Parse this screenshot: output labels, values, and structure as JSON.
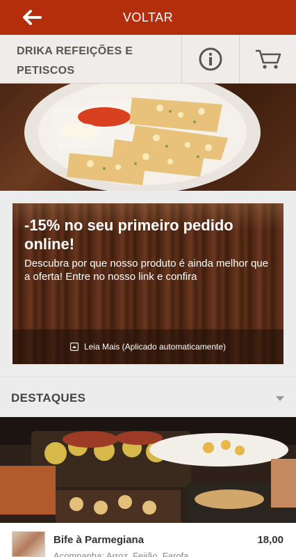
{
  "topbar": {
    "title": "VOLTAR"
  },
  "header": {
    "restaurant_name": "DRIKA REFEIÇÕES E PETISCOS"
  },
  "promo": {
    "title": "-15% no seu primeiro pedido online!",
    "description": "Descubra por que nosso produto é ainda melhor que a oferta! Entre no nosso link e confira",
    "footer_label": "Leia Mais (Aplicado automaticamente)"
  },
  "section": {
    "title": "DESTAQUES"
  },
  "items": [
    {
      "name": "Bife à Parmegiana",
      "price": "18,00",
      "description": "Acompanha: Arroz, Feijão, Farofa..."
    }
  ],
  "icons": {
    "back": "arrow-left-icon",
    "info": "info-icon",
    "cart": "cart-icon",
    "promo": "expand-icon",
    "section": "chevron-down-icon"
  },
  "colors": {
    "topbar": "#b52e0b",
    "header_icons": "#555555"
  }
}
